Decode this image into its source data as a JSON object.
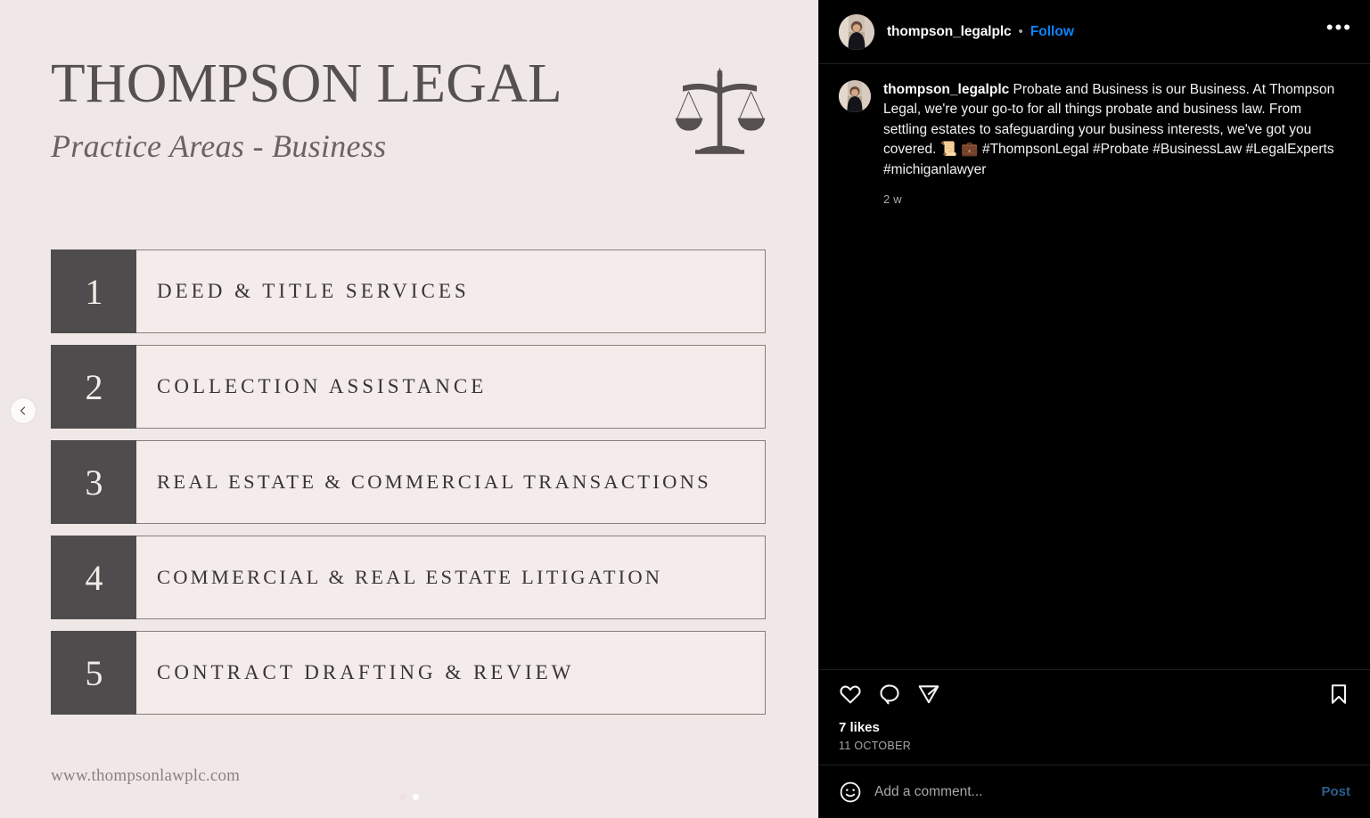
{
  "post_image": {
    "brand_title": "THOMPSON LEGAL",
    "brand_subtitle": "Practice Areas - Business",
    "logo_icon": "scales-of-justice-icon",
    "website": "www.thompsonlawplc.com",
    "background_color": "#f0e8e6",
    "number_block_color": "#4e4c4c",
    "items": [
      {
        "number": "1",
        "label": "DEED & TITLE SERVICES"
      },
      {
        "number": "2",
        "label": "COLLECTION ASSISTANCE"
      },
      {
        "number": "3",
        "label": "REAL ESTATE & COMMERCIAL TRANSACTIONS"
      },
      {
        "number": "4",
        "label": "COMMERCIAL & REAL ESTATE LITIGATION"
      },
      {
        "number": "5",
        "label": "CONTRACT DRAFTING & REVIEW"
      }
    ],
    "carousel": {
      "prev_icon": "chevron-left-icon",
      "dots": [
        {
          "active": false
        },
        {
          "active": true
        }
      ]
    }
  },
  "instagram": {
    "header": {
      "username": "thompson_legalplc",
      "separator": "•",
      "follow_label": "Follow",
      "more_label": "•••",
      "avatar_icon": "profile-avatar"
    },
    "caption": {
      "username": "thompson_legalplc",
      "text": "Probate and Business is our Business. At Thompson Legal, we're your go-to for all things probate and business law. From settling estates to safeguarding your business interests, we've got you covered. 📜 💼 #ThompsonLegal #Probate #BusinessLaw #LegalExperts #michiganlawyer",
      "timestamp": "2 w"
    },
    "actions": {
      "like_icon": "heart-icon",
      "comment_icon": "comment-icon",
      "share_icon": "share-icon",
      "save_icon": "bookmark-icon"
    },
    "likes_text": "7 likes",
    "post_date": "11 OCTOBER",
    "comment_bar": {
      "emoji_icon": "emoji-smiley-icon",
      "placeholder": "Add a comment...",
      "value": "",
      "post_label": "Post",
      "post_color": "#2a5f8f"
    },
    "accent_color": "#0a84ff",
    "background_color": "#000000"
  }
}
